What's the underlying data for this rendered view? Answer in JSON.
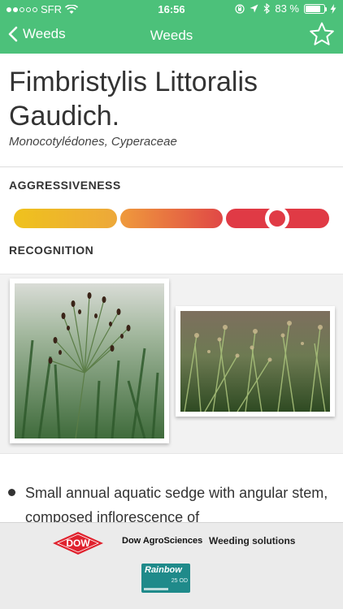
{
  "status_bar": {
    "carrier": "SFR",
    "time": "16:56",
    "battery_text": "83 %",
    "battery_level": 0.83,
    "signal_bars": 2,
    "icons": [
      "wifi-icon",
      "orientation-lock-icon",
      "location-arrow-icon",
      "bluetooth-icon",
      "charging-bolt-icon"
    ]
  },
  "nav": {
    "back_label": "Weeds",
    "title": "Weeds",
    "favorite_icon": "star-outline-icon"
  },
  "weed": {
    "name": "Fimbristylis Littoralis Gaudich.",
    "classification": "Monocotylédones, Cyperaceae"
  },
  "aggressiveness": {
    "label": "AGGRESSIVENESS",
    "scale_segments": 3,
    "level_segment": 3,
    "colors": [
      "#efc21d",
      "#ef9a3c",
      "#e03a45"
    ]
  },
  "recognition": {
    "label": "RECOGNITION",
    "photos": [
      "sedge-closeup-photo",
      "sedge-field-photo"
    ]
  },
  "description": {
    "text": "Small annual aquatic sedge with angular stem, composed inflorescence of"
  },
  "footer": {
    "dow_logo_text": "DOW",
    "brand": "Dow AgroSciences",
    "tagline": "Weeding solutions",
    "product_name": "Rainbow",
    "product_sub": "25 OD",
    "colors": {
      "header_green": "#4cc17a",
      "dow_red": "#e0222e",
      "rainbow_teal": "#1f8a8a"
    }
  }
}
